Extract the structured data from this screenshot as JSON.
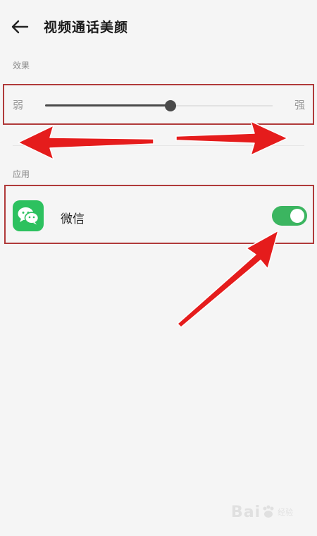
{
  "header": {
    "title": "视频通话美颜",
    "back_icon": "arrow-left-icon"
  },
  "effect_section": {
    "label": "效果",
    "slider": {
      "min_label": "弱",
      "max_label": "强",
      "value_percent": 55
    }
  },
  "apps_section": {
    "label": "应用",
    "items": [
      {
        "name": "微信",
        "icon": "wechat-icon",
        "enabled": true
      }
    ]
  },
  "watermark": {
    "text": "Bai",
    "sub": "经验"
  },
  "colors": {
    "accent_green": "#3bb560",
    "wechat_green": "#2dc15f",
    "annotation_red": "#e51c1c",
    "highlight_border": "#b03a3a"
  }
}
